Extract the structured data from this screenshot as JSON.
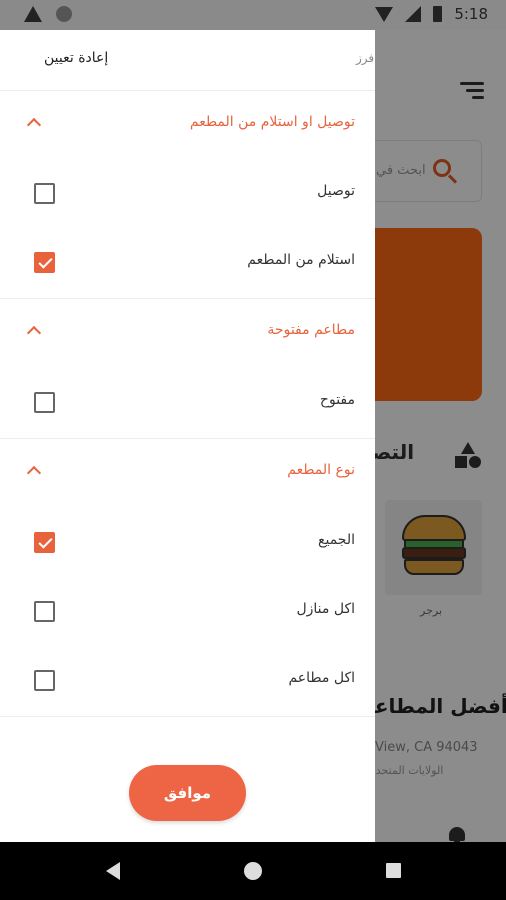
{
  "status_bar": {
    "time": "5:18"
  },
  "background": {
    "search_placeholder": "ابحث في",
    "categories_title": "التصـ",
    "category_item": "برجر",
    "best_restaurants": "أفضل المطاعـ",
    "location_line1": "View, CA 94043",
    "location_line2": "الولايات المتحدة"
  },
  "drawer": {
    "reset_label": "إعادة تعيين",
    "header_clipped": "فرز",
    "sections": [
      {
        "title": "توصيل او استلام من المطعم",
        "options": [
          {
            "label": "توصيل",
            "checked": false
          },
          {
            "label": "استلام من المطعم",
            "checked": true
          }
        ]
      },
      {
        "title": "مطاعم مفتوحة",
        "options": [
          {
            "label": "مفتوح",
            "checked": false
          }
        ]
      },
      {
        "title": "نوع المطعم",
        "options": [
          {
            "label": "الجميع",
            "checked": true
          },
          {
            "label": "اكل منازل",
            "checked": false
          },
          {
            "label": "اكل مطاعم",
            "checked": false
          }
        ]
      }
    ],
    "ok_label": "موافق"
  },
  "colors": {
    "accent": "#e8633c",
    "button": "#ee6545",
    "banner": "#ff6a14"
  }
}
